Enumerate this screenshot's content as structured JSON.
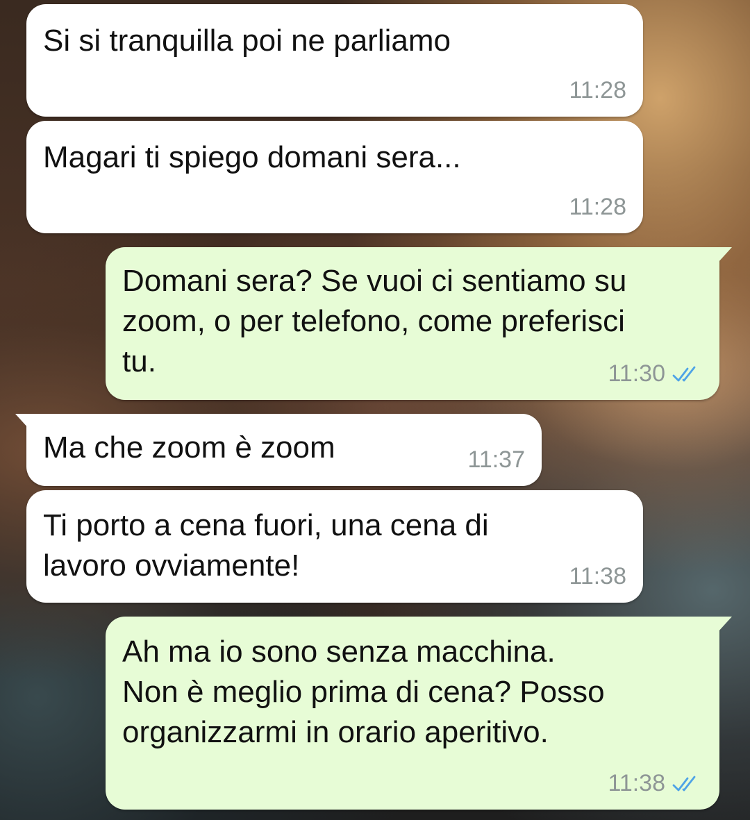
{
  "messages": [
    {
      "direction": "incoming",
      "text": "Si si tranquilla poi ne parliamo",
      "time": "11:28"
    },
    {
      "direction": "incoming",
      "text": "Magari ti spiego domani sera...",
      "time": "11:28"
    },
    {
      "direction": "outgoing",
      "text": "Domani sera? Se vuoi ci sentiamo su\nzoom, o per telefono, come preferisci\ntu.",
      "time": "11:30",
      "status": "read",
      "status_icon": "double-check-icon"
    },
    {
      "direction": "incoming",
      "text": "Ma che zoom è zoom",
      "time": "11:37"
    },
    {
      "direction": "incoming",
      "text": "Ti porto a cena fuori, una cena di\nlavoro ovviamente!",
      "time": "11:38"
    },
    {
      "direction": "outgoing",
      "text": "Ah ma io sono senza macchina.\nNon è meglio prima di cena? Posso\norganizzarmi in orario aperitivo.",
      "time": "11:38",
      "status": "read",
      "status_icon": "double-check-icon"
    }
  ],
  "colors": {
    "incoming_bubble": "#ffffff",
    "outgoing_bubble": "#e7fcd6",
    "timestamp": "#8e9696",
    "read_tick": "#4fa3e6"
  }
}
